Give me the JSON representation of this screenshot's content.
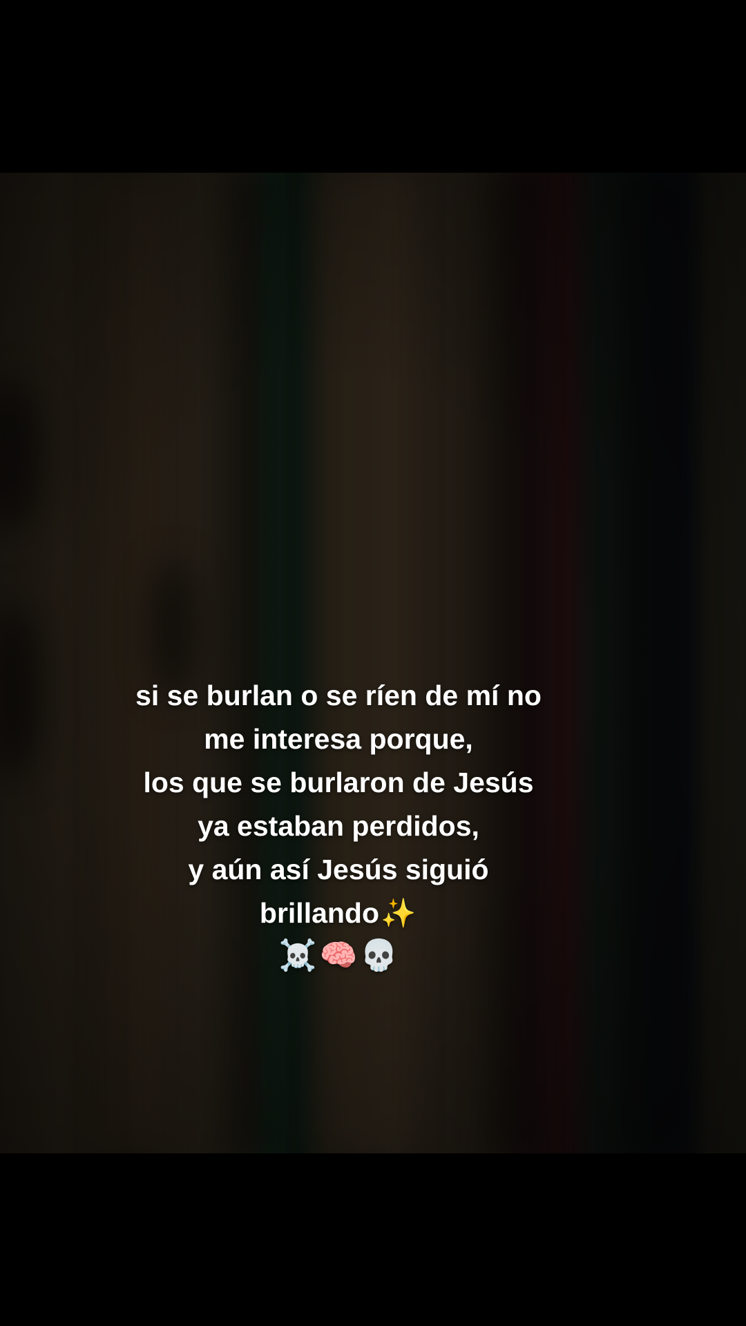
{
  "caption": {
    "line1": "si se burlan o se ríen de mí no",
    "line2": "me interesa porque,",
    "line3": "los que se burlaron de Jesús",
    "line4": "ya estaban perdidos,",
    "line5": "y aún así Jesús siguió",
    "line6": "brillando",
    "sparkle_emoji": "✨",
    "emojis": {
      "skull_crossbones": "☠️",
      "brain": "🧠",
      "skull": "💀"
    }
  },
  "icons": {
    "sparkle": "sparkles-icon",
    "skull_crossbones": "skull-and-crossbones-icon",
    "brain": "brain-icon",
    "skull": "skull-icon"
  },
  "colors": {
    "background": "#000000",
    "text": "#ffffff",
    "curtain_brown": "#211b13",
    "curtain_green": "#0f1a12",
    "curtain_red": "#1a0b0c"
  }
}
